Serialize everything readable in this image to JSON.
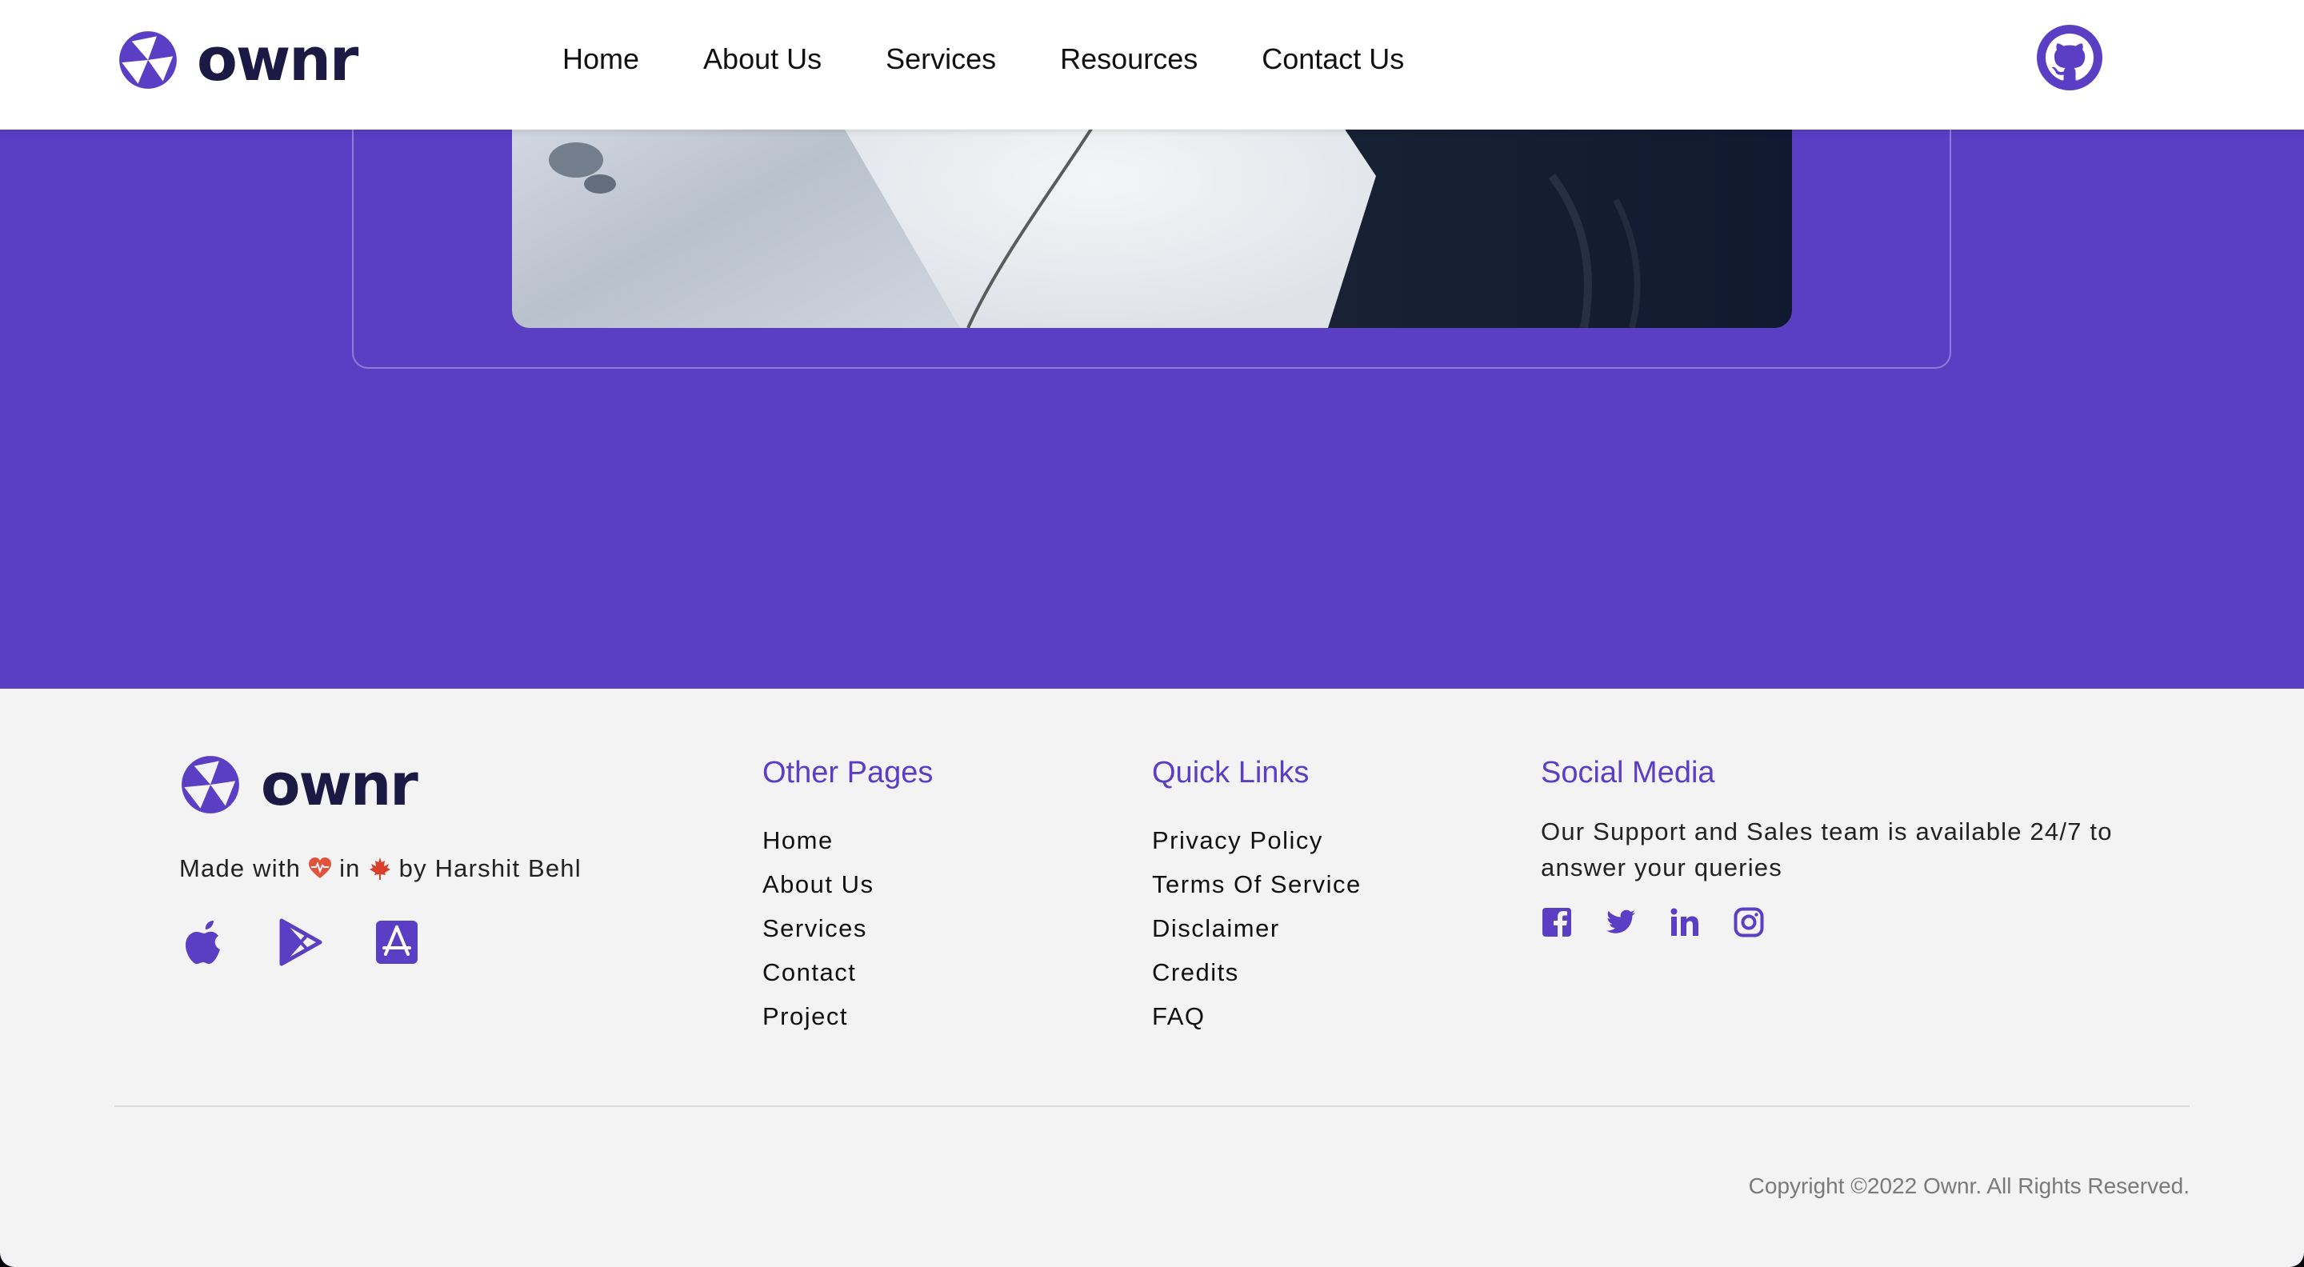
{
  "brand": {
    "name": "ownr"
  },
  "colors": {
    "accent": "#5a3ec3",
    "brand_text": "#1c1a45",
    "footer_bg": "#f3f3f3",
    "heart": "#e0533d",
    "maple_leaf": "#d7402c"
  },
  "header": {
    "nav": [
      {
        "label": "Home"
      },
      {
        "label": "About Us"
      },
      {
        "label": "Services"
      },
      {
        "label": "Resources"
      },
      {
        "label": "Contact Us"
      }
    ],
    "github_icon": "github-icon"
  },
  "footer": {
    "made_with": {
      "prefix": "Made with",
      "middle": "in",
      "suffix": "by Harshit Behl",
      "icons": [
        "heart-pulse-icon",
        "maple-leaf-icon"
      ]
    },
    "app_icons": [
      "apple-icon",
      "google-play-icon",
      "app-store-icon"
    ],
    "other_pages": {
      "title": "Other Pages",
      "links": [
        "Home",
        "About Us",
        "Services",
        "Contact",
        "Project"
      ]
    },
    "quick_links": {
      "title": "Quick Links",
      "links": [
        "Privacy Policy",
        "Terms Of Service",
        "Disclaimer",
        "Credits",
        "FAQ"
      ]
    },
    "social_media": {
      "title": "Social Media",
      "description": "Our Support and Sales team is available 24/7 to answer your queries",
      "icons": [
        "facebook-icon",
        "twitter-icon",
        "linkedin-icon",
        "instagram-icon"
      ]
    },
    "copyright": "Copyright ©2022 Ownr. All Rights Reserved."
  }
}
